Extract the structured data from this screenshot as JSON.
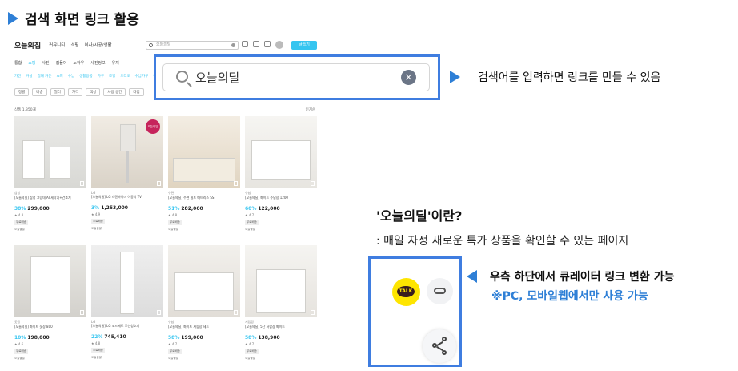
{
  "header": {
    "title": "검색 화면 링크 활용"
  },
  "screenshot": {
    "logo": "오늘의집",
    "nav_links": [
      "커뮤니티",
      "쇼핑",
      "이사/시공/생활"
    ],
    "mini_search_query": "오늘의딜",
    "write_button": "글쓰기",
    "tabs": [
      "통합",
      "쇼핑",
      "사진",
      "집들이",
      "노하우",
      "사진정보",
      "유저"
    ],
    "subtabs": [
      "가전",
      "거실",
      "침대 커튼",
      "쇼파",
      "수납",
      "생활용품",
      "가구",
      "조명",
      "오디오",
      "수납가구",
      "주방용품"
    ],
    "filters": [
      "정렬",
      "배송",
      "필터",
      "가격",
      "색상",
      "사용 공간",
      "타입"
    ],
    "count_label": "상품 1,350개",
    "sort_label": "인기순",
    "products": [
      {
        "meta": "삼성",
        "name": "[오늘의딜] 삼성 그랑데 AI 세탁기+건조기",
        "discount": "38%",
        "price": "299,000",
        "rating": "★ 4.8",
        "tag": "무료배송",
        "ship": "오늘출발"
      },
      {
        "meta": "LG",
        "name": "[오늘의딜] LG 스탠바이미 이동식 TV",
        "discount": "3%",
        "price": "1,253,000",
        "rating": "★ 4.9",
        "tag": "무료배송",
        "ship": "오늘출발"
      },
      {
        "meta": "수면",
        "name": "[오늘의딜] 수면 필드 매트리스 SS",
        "discount": "51%",
        "price": "282,000",
        "rating": "★ 4.8",
        "tag": "무료배송",
        "ship": "오늘출발"
      },
      {
        "meta": "수납",
        "name": "[오늘의딜] 화이트 수납장 1200",
        "discount": "60%",
        "price": "122,000",
        "rating": "★ 4.7",
        "tag": "무료배송",
        "ship": "오늘출발"
      },
      {
        "meta": "옷장",
        "name": "[오늘의딜] 화이트 옷장 800",
        "discount": "10%",
        "price": "198,000",
        "rating": "★ 4.6",
        "tag": "무료배송",
        "ship": "오늘출발"
      },
      {
        "meta": "LG",
        "name": "[오늘의딜] LG 코드제로 무선청소기",
        "discount": "22%",
        "price": "745,410",
        "rating": "★ 4.8",
        "tag": "무료배송",
        "ship": "오늘출발"
      },
      {
        "meta": "수납",
        "name": "[오늘의딜] 화이트 서랍장 세트",
        "discount": "58%",
        "price": "199,000",
        "rating": "★ 4.7",
        "tag": "무료배송",
        "ship": "오늘출발"
      },
      {
        "meta": "서랍장",
        "name": "[오늘의딜] 5단 서랍장 화이트",
        "discount": "58%",
        "price": "138,900",
        "rating": "★ 4.7",
        "tag": "무료배송",
        "ship": "오늘출발"
      }
    ],
    "card2_badge": "오늘의딜"
  },
  "search_callout": {
    "query": "오늘의딜",
    "clear_glyph": "×"
  },
  "notes": {
    "search": "검색어를 입력하면 링크를 만들 수 있음",
    "question_title": "'오늘의딜'이란?",
    "question_desc": ": 매일 자정 새로운 특가 상품을 확인할 수 있는 페이지",
    "share": "우측 하단에서 큐레이터 링크 변환 가능",
    "platform": "※PC, 모바일웹에서만 사용 가능"
  },
  "share_widget": {
    "talk_label": "TALK",
    "talk_icon": "kakaotalk-icon",
    "link_icon": "link-icon",
    "share_icon": "share-icon"
  },
  "colors": {
    "accent": "#2e7fd6",
    "callout_border": "#3f7de0",
    "brand": "#35c5f0",
    "kakao_yellow": "#fee500"
  }
}
